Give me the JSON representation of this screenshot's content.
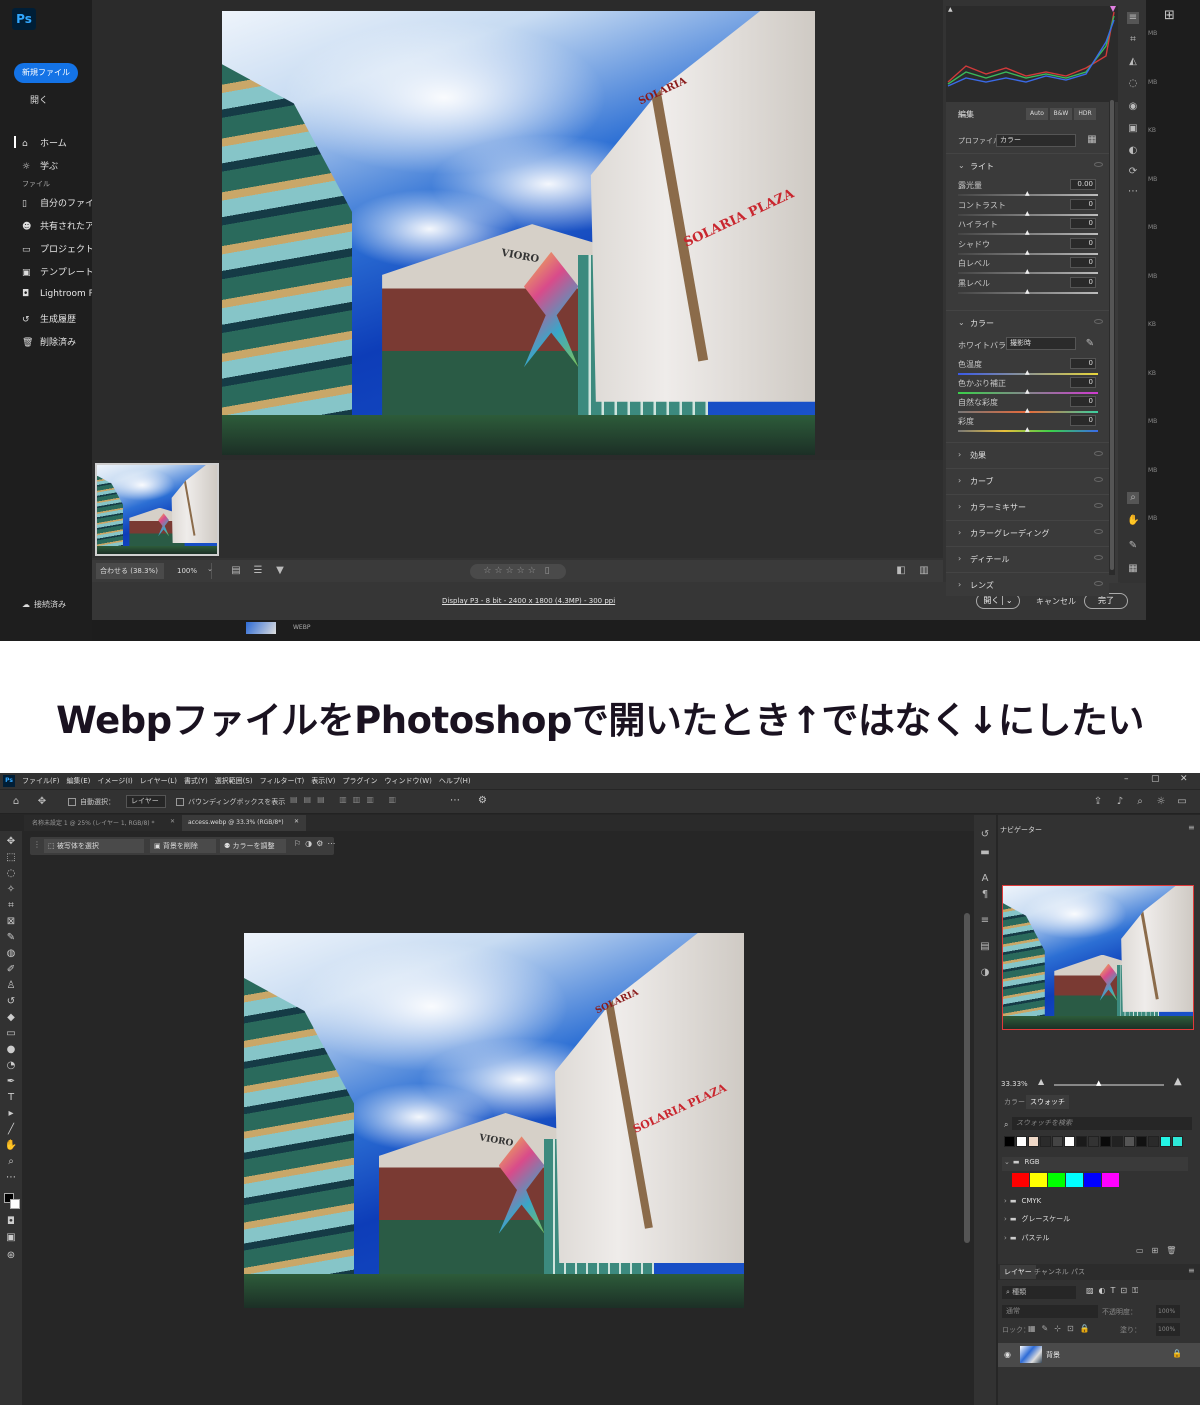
{
  "acr": {
    "logo": "Ps",
    "new_file_button": "新規ファイル",
    "open_link": "開く",
    "nav": {
      "home": "ホーム",
      "learn": "学ぶ",
      "files_heading": "ファイル",
      "my_files": "自分のファイル",
      "shared": "共有されたアイ",
      "projects": "プロジェクト",
      "templates": "テンプレート",
      "lightroom": "Lightroom Ph",
      "gen_history": "生成履歴",
      "deleted": "削除済み"
    },
    "connected": "接続済み",
    "edit_header": "編集",
    "auto_btn": "Auto",
    "bw_btn": "B&W",
    "hdr_btn": "HDR",
    "profile_label": "プロファイル",
    "profile_value": "カラー",
    "light_section": "ライト",
    "light_rows": [
      {
        "label": "露光量",
        "value": "0.00"
      },
      {
        "label": "コントラスト",
        "value": "0"
      },
      {
        "label": "ハイライト",
        "value": "0"
      },
      {
        "label": "シャドウ",
        "value": "0"
      },
      {
        "label": "白レベル",
        "value": "0"
      },
      {
        "label": "黒レベル",
        "value": "0"
      }
    ],
    "color_section": "カラー",
    "wb_label": "ホワイトバランス",
    "wb_value": "撮影時",
    "color_rows": [
      {
        "label": "色温度",
        "value": "0"
      },
      {
        "label": "色かぶり補正",
        "value": "0"
      },
      {
        "label": "自然な彩度",
        "value": "0"
      },
      {
        "label": "彩度",
        "value": "0"
      }
    ],
    "collapsed_sections": [
      "効果",
      "カーブ",
      "カラーミキサー",
      "カラーグレーディング",
      "ディテール",
      "レンズ"
    ],
    "zoom_fit": "合わせる (38.3%)",
    "zoom_100": "100%",
    "file_info": "Display P3 - 8 bit - 2400 x 1800 (4.3MP) - 300 ppi",
    "open_button": "開く",
    "cancel_button": "キャンセル",
    "done_button": "完了",
    "bg_format": "WEBP",
    "side_sizes": [
      "MB",
      "MB",
      "KB",
      "MB",
      "MB",
      "MB",
      "KB",
      "KB",
      "MB",
      "MB",
      "MB"
    ]
  },
  "caption": {
    "text": "Webpファイルを​Photoshopで開いたとき↑ではなく↓にしたい"
  },
  "photo": {
    "sign_solaria": "SOLARIA",
    "sign_plaza": "SOLARIA PLAZA",
    "sign_vioro": "VIORO"
  },
  "ps": {
    "logo": "Ps",
    "menu": [
      "ファイル(F)",
      "編集(E)",
      "イメージ(I)",
      "レイヤー(L)",
      "書式(Y)",
      "選択範囲(S)",
      "フィルター(T)",
      "表示(V)",
      "プラグイン",
      "ウィンドウ(W)",
      "ヘルプ(H)"
    ],
    "auto_select": "自動選択：",
    "layer_dropdown": "レイヤー",
    "bbox_label": "バウンディングボックスを表示",
    "tab1": "名称未設定 1 @ 25% (レイヤー 1, RGB/8) *",
    "tab2": "access.webp @ 33.3% (RGB/8*)",
    "ctx_select_subject": "被写体を選択",
    "ctx_remove_bg": "背景を削除",
    "ctx_adjust_color": "カラーを調整",
    "navigator_tab": "ナビゲーター",
    "nav_zoom": "33.33%",
    "color_tab": "カラー",
    "swatches_tab": "スウォッチ",
    "swatch_search": "スウォッチを検索",
    "swatch_groups": [
      "RGB",
      "CMYK",
      "グレースケール",
      "パステル"
    ],
    "layers_tab": "レイヤー",
    "channels_tab": "チャンネル",
    "paths_tab": "パス",
    "kind_label": "種類",
    "blend_mode": "通常",
    "opacity_label": "不透明度：",
    "opacity_value": "100%",
    "lock_label": "ロック：",
    "fill_label": "塗り：",
    "fill_value": "100%",
    "layer_name": "背景",
    "colors": {
      "bg": "#262626",
      "panel": "#323232",
      "accent": "#1473e6",
      "nav_frame": "#e03a3a"
    },
    "top_swatches": [
      "#000000",
      "#ffffff",
      "#f0d9c8",
      "#2b2b2b",
      "#444444",
      "#ffffff",
      "#1a1a1a",
      "#333333",
      "#0a0a0a",
      "#222222",
      "#555555",
      "#111111",
      "#2a2a2a",
      "#24f5e6",
      "#2ee8d8"
    ],
    "rgb_swatches": [
      "#ff0000",
      "#ffff00",
      "#00ff00",
      "#00ffff",
      "#0000ff",
      "#ff00ff"
    ]
  }
}
